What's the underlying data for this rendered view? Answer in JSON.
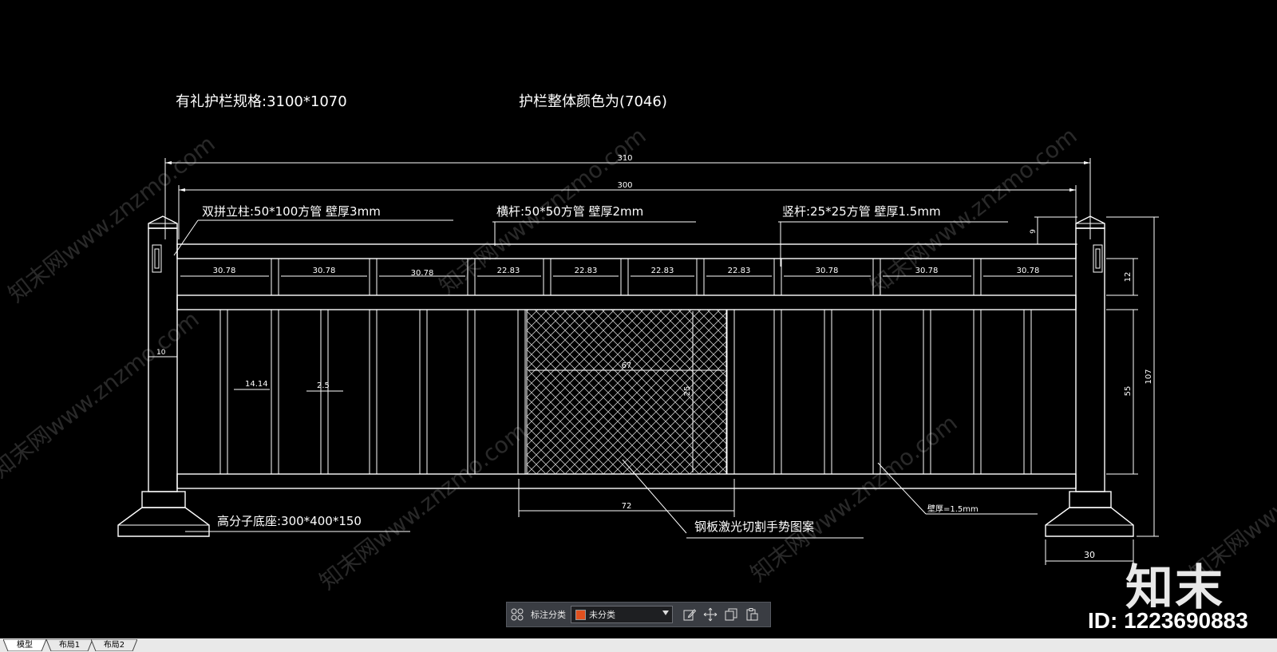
{
  "drawing": {
    "spec_label": "有礼护栏规格:3100*1070",
    "color_label": "护栏整体颜色为(7046)",
    "callouts": {
      "post": "双拼立柱:50*100方管  壁厚3mm",
      "rail": "横杆:50*50方管  壁厚2mm",
      "baluster": "竖杆:25*25方管  壁厚1.5mm",
      "base": "高分子底座:300*400*150",
      "panel": "钢板激光切割手势图案",
      "wall": "壁厚=1.5mm"
    },
    "dims": {
      "overall": "310",
      "inner": "300",
      "top_gap": "9",
      "band_height": "12",
      "total_height": "107",
      "lower_height": "55",
      "post_width": "10",
      "base_width": "30",
      "panel_width": "72",
      "panel_inner": "67",
      "panel_inner_v": "25",
      "baluster_gap": "14.14",
      "baluster_w": "2.5",
      "seg_a": "30.78",
      "seg_b": "22.83",
      "seg_list": [
        "30.78",
        "30.78",
        "30.78",
        "22.83",
        "22.83",
        "22.83",
        "22.83",
        "30.78",
        "30.78",
        "30.78"
      ]
    }
  },
  "watermark": {
    "text": "知末网www.znzmo.com",
    "logo": "知末",
    "id": "ID: 1223690883"
  },
  "toolbar": {
    "label": "标注分类",
    "select_value": "未分类",
    "swatch_color": "#e0501e"
  },
  "tabs": [
    "模型",
    "布局1",
    "布局2"
  ]
}
